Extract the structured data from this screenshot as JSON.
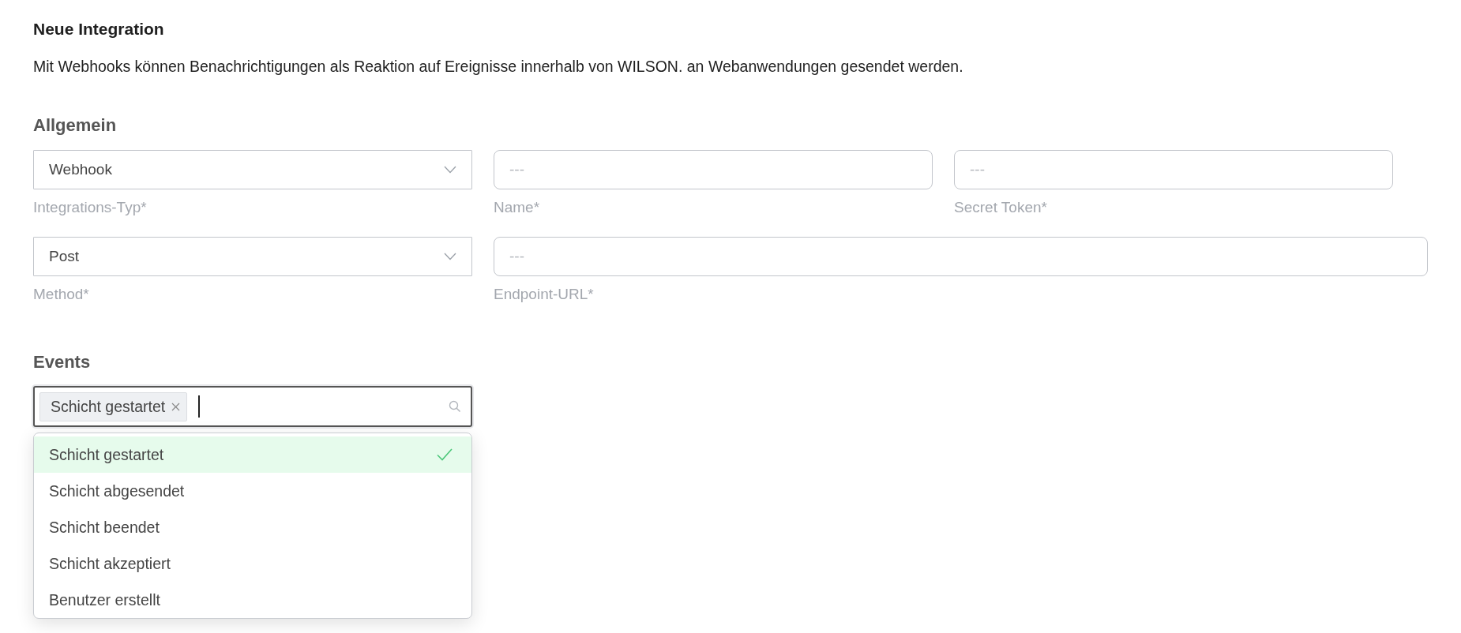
{
  "title": "Neue Integration",
  "description": "Mit Webhooks können Benachrichtigungen als Reaktion auf Ereignisse innerhalb von WILSON. an Webanwendungen gesendet werden.",
  "general": {
    "heading": "Allgemein",
    "rows": [
      [
        {
          "kind": "select",
          "value": "Webhook",
          "label": "Integrations-Typ*"
        },
        {
          "kind": "text",
          "placeholder": "---",
          "label": "Name*"
        },
        {
          "kind": "text",
          "placeholder": "---",
          "label": "Secret Token*"
        }
      ],
      [
        {
          "kind": "select",
          "value": "Post",
          "label": "Method*"
        },
        {
          "kind": "text",
          "placeholder": "---",
          "label": "Endpoint-URL*"
        }
      ]
    ]
  },
  "events": {
    "heading": "Events",
    "tags": [
      {
        "label": "Schicht gestartet",
        "removable": true
      }
    ],
    "options": [
      {
        "label": "Schicht gestartet",
        "selected": true
      },
      {
        "label": "Schicht abgesendet",
        "selected": false
      },
      {
        "label": "Schicht beendet",
        "selected": false
      },
      {
        "label": "Schicht akzeptiert",
        "selected": false
      },
      {
        "label": "Benutzer erstellt",
        "selected": false
      }
    ]
  }
}
